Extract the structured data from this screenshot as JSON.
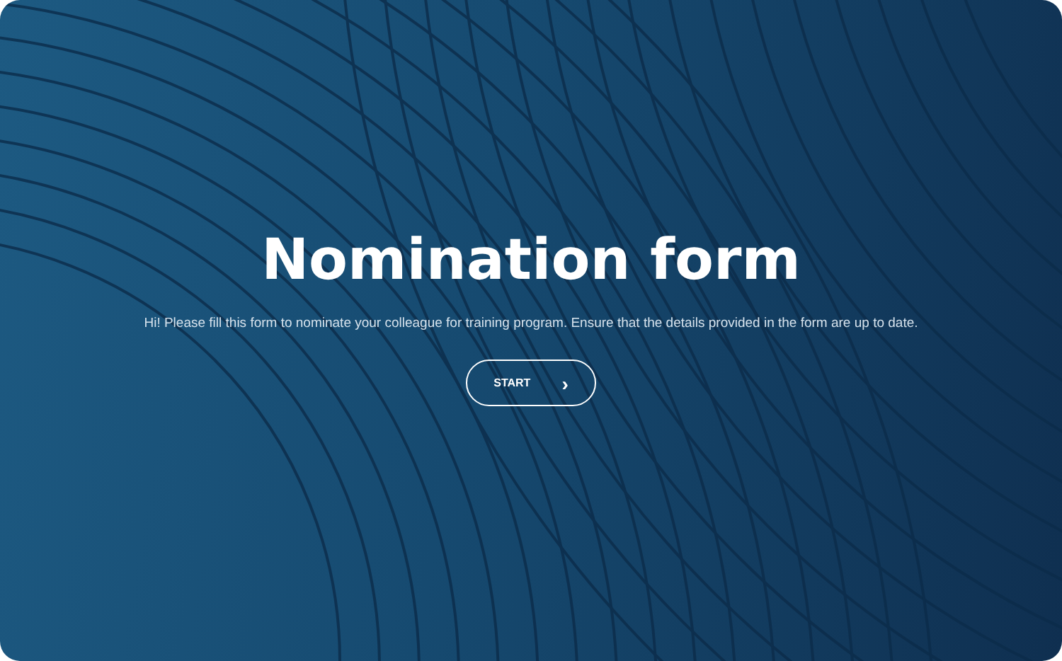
{
  "title": "Nomination form",
  "description": "Hi! Please fill this form to nominate your colleague for training program. Ensure that the details provided in the form are up to date.",
  "button": {
    "label": "START",
    "icon": "›"
  }
}
